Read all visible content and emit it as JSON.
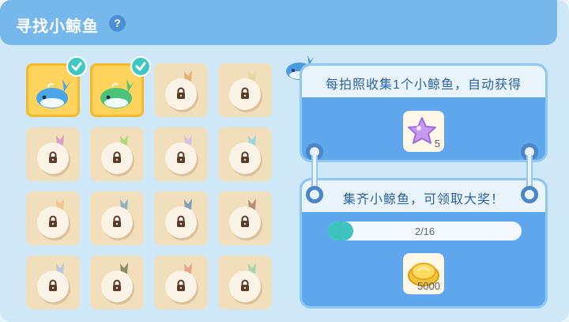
{
  "header": {
    "title": "寻找小鲸鱼",
    "help_glyph": "?"
  },
  "collection": {
    "tiles": [
      {
        "state": "collected",
        "color": "#4aa6e6"
      },
      {
        "state": "collected",
        "color": "#4cc27a"
      },
      {
        "state": "locked",
        "tail_color": "#e8b07a"
      },
      {
        "state": "locked",
        "tail_color": "#e6d8a0"
      },
      {
        "state": "locked",
        "tail_color": "#d9a0c6"
      },
      {
        "state": "locked",
        "tail_color": "#b6d77e"
      },
      {
        "state": "locked",
        "tail_color": "#d8c0e0"
      },
      {
        "state": "locked",
        "tail_color": "#9fd3df"
      },
      {
        "state": "locked",
        "tail_color": "#f3c58a"
      },
      {
        "state": "locked",
        "tail_color": "#8fb2c9"
      },
      {
        "state": "locked",
        "tail_color": "#7fa0b8"
      },
      {
        "state": "locked",
        "tail_color": "#b58f7a"
      },
      {
        "state": "locked",
        "tail_color": "#bcc9d8"
      },
      {
        "state": "locked",
        "tail_color": "#8f8a6a"
      },
      {
        "state": "locked",
        "tail_color": "#e8a58a"
      },
      {
        "state": "locked",
        "tail_color": "#a8d4b0"
      }
    ]
  },
  "reward_card_1": {
    "text": "每拍照收集1个小鲸鱼，自动获得",
    "item_icon": "purple-star-icon",
    "item_amount": "5"
  },
  "reward_card_2": {
    "text": "集齐小鲸鱼，可领取大奖！",
    "progress_text": "2/16",
    "progress_fraction": 0.125,
    "item_icon": "gold-coins-icon",
    "item_amount": "5000"
  },
  "colors": {
    "header_bg": "#76b8ec",
    "accent_teal": "#3ec3bf",
    "card_blue": "#5fa7ec",
    "tile_locked": "#f1deba",
    "tile_collected": "#ffd35c"
  }
}
